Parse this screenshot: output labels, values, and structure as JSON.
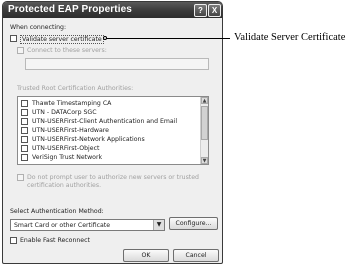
{
  "dialog": {
    "title": "Protected EAP Properties",
    "help_glyph": "?",
    "close_glyph": "X",
    "when_connecting": "When connecting:",
    "validate_server_cert": "Validate server certificate",
    "connect_to_servers": "Connect to these servers:",
    "trusted_root_label": "Trusted Root Certification Authorities:",
    "ca_list": [
      "Thawte Timestamping CA",
      "UTN - DATACorp SGC",
      "UTN-USERFirst-Client Authentication and Email",
      "UTN-USERFirst-Hardware",
      "UTN-USERFirst-Network Applications",
      "UTN-USERFirst-Object",
      "VeriSign Trust Network"
    ],
    "do_not_prompt_line1": "Do not prompt user to authorize new servers or trusted",
    "do_not_prompt_line2": "certification authorities.",
    "select_auth_method": "Select Authentication Method:",
    "auth_method_value": "Smart Card or other Certificate",
    "configure_button": "Configure...",
    "fast_reconnect": "Enable Fast Reconnect",
    "ok_button": "OK",
    "cancel_button": "Cancel"
  },
  "callout": {
    "label": "Validate Server Certificate"
  }
}
